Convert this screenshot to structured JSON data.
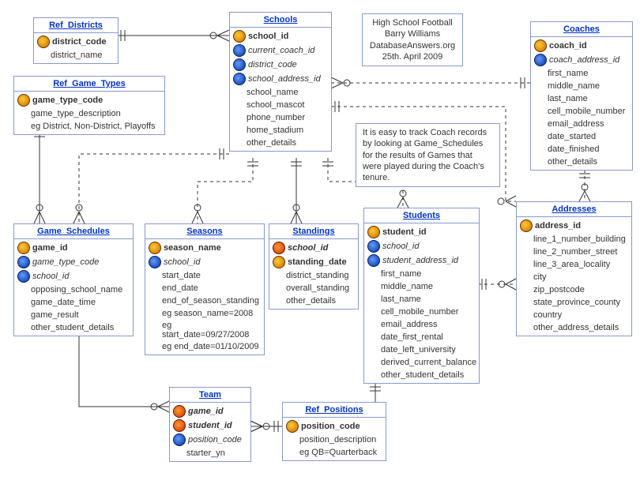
{
  "meta": {
    "title": "High School Football",
    "author": "Barry Williams",
    "site": "DatabaseAnswers.org",
    "date": "25th. April 2009"
  },
  "comment": "It is easy to track Coach records by looking at Game_Schedules for the results of Games that were played during the Coach's tenure.",
  "entities": {
    "ref_districts": {
      "title": "Ref_Districts",
      "fields": [
        {
          "key": "pk",
          "name": "district_code",
          "bold": true
        },
        {
          "key": "",
          "name": "district_name"
        }
      ]
    },
    "ref_game_types": {
      "title": "Ref_Game_Types",
      "fields": [
        {
          "key": "pk",
          "name": "game_type_code",
          "bold": true
        },
        {
          "key": "",
          "name": "game_type_description"
        },
        {
          "key": "",
          "name": "eg District, Non-District, Playoffs"
        }
      ]
    },
    "schools": {
      "title": "Schools",
      "fields": [
        {
          "key": "pk",
          "name": "school_id",
          "bold": true
        },
        {
          "key": "fk",
          "name": "current_coach_id",
          "italic": true
        },
        {
          "key": "fk",
          "name": "district_code",
          "italic": true
        },
        {
          "key": "fk",
          "name": "school_address_id",
          "italic": true
        },
        {
          "key": "",
          "name": "school_name"
        },
        {
          "key": "",
          "name": "school_mascot"
        },
        {
          "key": "",
          "name": "phone_number"
        },
        {
          "key": "",
          "name": "home_stadium"
        },
        {
          "key": "",
          "name": "other_details"
        }
      ]
    },
    "coaches": {
      "title": "Coaches",
      "fields": [
        {
          "key": "pk",
          "name": "coach_id",
          "bold": true
        },
        {
          "key": "fk",
          "name": "coach_address_id",
          "italic": true
        },
        {
          "key": "",
          "name": "first_name"
        },
        {
          "key": "",
          "name": "middle_name"
        },
        {
          "key": "",
          "name": "last_name"
        },
        {
          "key": "",
          "name": "cell_mobile_number"
        },
        {
          "key": "",
          "name": "email_address"
        },
        {
          "key": "",
          "name": "date_started"
        },
        {
          "key": "",
          "name": "date_finished"
        },
        {
          "key": "",
          "name": "other_details"
        }
      ]
    },
    "game_schedules": {
      "title": "Game_Schedules",
      "fields": [
        {
          "key": "pk",
          "name": "game_id",
          "bold": true
        },
        {
          "key": "fk",
          "name": "game_type_code",
          "italic": true
        },
        {
          "key": "fk",
          "name": "school_id",
          "italic": true
        },
        {
          "key": "",
          "name": "opposing_school_name"
        },
        {
          "key": "",
          "name": "game_date_time"
        },
        {
          "key": "",
          "name": "game_result"
        },
        {
          "key": "",
          "name": "other_student_details"
        }
      ]
    },
    "seasons": {
      "title": "Seasons",
      "fields": [
        {
          "key": "pk",
          "name": "season_name",
          "bold": true
        },
        {
          "key": "fk",
          "name": "school_id",
          "italic": true
        },
        {
          "key": "",
          "name": "start_date"
        },
        {
          "key": "",
          "name": "end_date"
        },
        {
          "key": "",
          "name": "end_of_season_standing"
        },
        {
          "key": "",
          "name": "eg season_name=2008"
        },
        {
          "key": "",
          "name": "eg start_date=09/27/2008"
        },
        {
          "key": "",
          "name": "eg end_date=01/10/2009"
        }
      ]
    },
    "standings": {
      "title": "Standings",
      "fields": [
        {
          "key": "pf",
          "name": "school_id",
          "bold": true,
          "italic": true
        },
        {
          "key": "pk",
          "name": "standing_date",
          "bold": true
        },
        {
          "key": "",
          "name": "district_standing"
        },
        {
          "key": "",
          "name": "overall_standing"
        },
        {
          "key": "",
          "name": "other_details"
        }
      ]
    },
    "students": {
      "title": "Students",
      "fields": [
        {
          "key": "pk",
          "name": "student_id",
          "bold": true
        },
        {
          "key": "fk",
          "name": "school_id",
          "italic": true
        },
        {
          "key": "fk",
          "name": "student_address_id",
          "italic": true
        },
        {
          "key": "",
          "name": "first_name"
        },
        {
          "key": "",
          "name": "middle_name"
        },
        {
          "key": "",
          "name": "last_name"
        },
        {
          "key": "",
          "name": "cell_mobile_number"
        },
        {
          "key": "",
          "name": "email_address"
        },
        {
          "key": "",
          "name": "date_first_rental"
        },
        {
          "key": "",
          "name": "date_left_university"
        },
        {
          "key": "",
          "name": "derived_current_balance"
        },
        {
          "key": "",
          "name": "other_student_details"
        }
      ]
    },
    "addresses": {
      "title": "Addresses",
      "fields": [
        {
          "key": "pk",
          "name": "address_id",
          "bold": true
        },
        {
          "key": "",
          "name": "line_1_number_building"
        },
        {
          "key": "",
          "name": "line_2_number_street"
        },
        {
          "key": "",
          "name": "line_3_area_locality"
        },
        {
          "key": "",
          "name": "city"
        },
        {
          "key": "",
          "name": "zip_postcode"
        },
        {
          "key": "",
          "name": "state_province_county"
        },
        {
          "key": "",
          "name": "country"
        },
        {
          "key": "",
          "name": "other_address_details"
        }
      ]
    },
    "team": {
      "title": "Team",
      "fields": [
        {
          "key": "pf",
          "name": "game_id",
          "bold": true,
          "italic": true
        },
        {
          "key": "pf",
          "name": "student_id",
          "bold": true,
          "italic": true
        },
        {
          "key": "fk",
          "name": "position_code",
          "italic": true
        },
        {
          "key": "",
          "name": "starter_yn"
        }
      ]
    },
    "ref_positions": {
      "title": "Ref_Positions",
      "fields": [
        {
          "key": "pk",
          "name": "position_code",
          "bold": true
        },
        {
          "key": "",
          "name": "position_description"
        },
        {
          "key": "",
          "name": "eg QB=Quarterback"
        }
      ]
    }
  }
}
